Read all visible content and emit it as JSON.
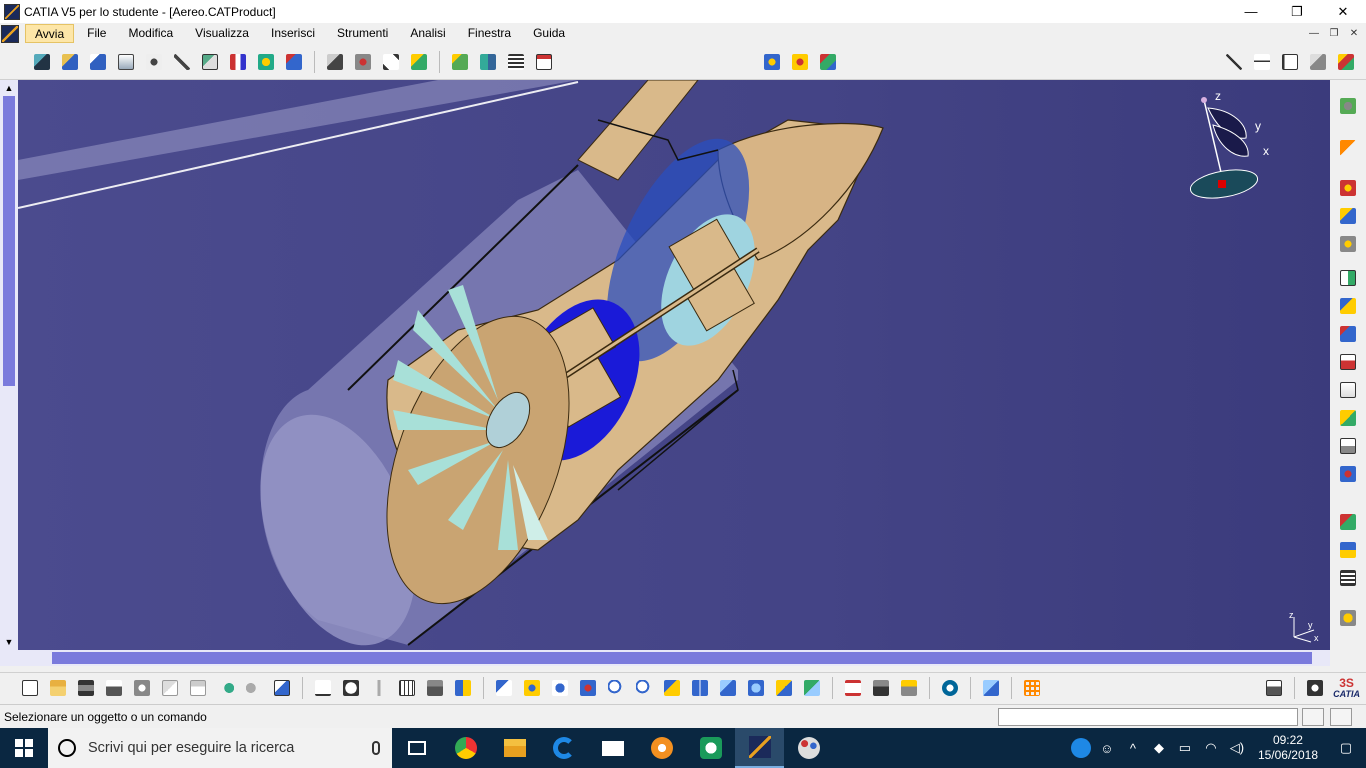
{
  "window": {
    "title": "CATIA V5 per lo studente - [Aereo.CATProduct]",
    "controls": [
      "—",
      "❐",
      "✕"
    ]
  },
  "menu": {
    "items": [
      {
        "label": "Avvia",
        "active": true
      },
      {
        "label": "File"
      },
      {
        "label": "Modifica"
      },
      {
        "label": "Visualizza"
      },
      {
        "label": "Inserisci"
      },
      {
        "label": "Strumenti"
      },
      {
        "label": "Analisi"
      },
      {
        "label": "Finestra"
      },
      {
        "label": "Guida"
      }
    ],
    "doc_controls": [
      "—",
      "❐",
      "✕"
    ]
  },
  "compass": {
    "labels": [
      "z",
      "y",
      "x"
    ]
  },
  "mini_axes": {
    "labels": [
      "z",
      "y",
      "x"
    ]
  },
  "status": {
    "text": "Selezionare un oggetto o un comando",
    "command_value": ""
  },
  "taskbar": {
    "search_placeholder": "Scrivi qui per eseguire la ricerca",
    "time": "09:22",
    "date": "15/06/2018"
  },
  "colors": {
    "viewport_bg": "#44448a",
    "engine_tan": "#d9b98a",
    "fan_blade": "#a8e0d8",
    "compressor_blue": "#1a1ad8",
    "nacelle": "#8a8abf"
  },
  "brand": {
    "logo_text": "CATIA"
  }
}
